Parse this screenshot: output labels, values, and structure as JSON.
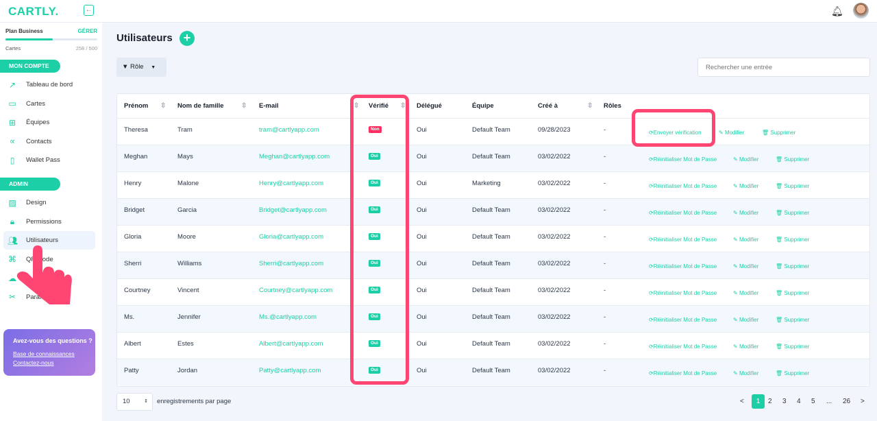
{
  "header": {
    "logo": "CARTLY.",
    "collapse_icon": "arrow-left-icon"
  },
  "plan": {
    "name": "Plan Business",
    "manage": "GÉRER",
    "cards_label": "Cartes",
    "cards_count": "258 / 500",
    "usage_fraction": 0.516
  },
  "sidebar": {
    "section_account": "MON COMPTE",
    "account_items": [
      {
        "label": "Tableau de bord",
        "icon": "↗"
      },
      {
        "label": "Cartes",
        "icon": "▭"
      },
      {
        "label": "Équipes",
        "icon": "⊞"
      },
      {
        "label": "Contacts",
        "icon": "∝"
      },
      {
        "label": "Wallet Pass",
        "icon": "▯"
      }
    ],
    "section_admin": "ADMIN",
    "admin_items": [
      {
        "label": "Design",
        "icon": "▨"
      },
      {
        "label": "Permissions",
        "icon": "🔒︎"
      },
      {
        "label": "Utilisateurs",
        "icon": "👥︎"
      },
      {
        "label": "QR Code",
        "icon": "⌘"
      },
      {
        "label": "",
        "icon": "☁"
      },
      {
        "label": "Paramètres",
        "icon": "✂"
      }
    ],
    "help": {
      "title": "Avez-vous des questions ?",
      "kb": "Base de connaissances",
      "contact": "Contactez-nous"
    }
  },
  "main": {
    "title": "Utilisateurs",
    "filter": "Rôle",
    "search_placeholder": "Rechercher une entrée"
  },
  "table": {
    "headers": [
      "Prénom",
      "Nom de famille",
      "E-mail",
      "Vérifié",
      "Délégué",
      "Équipe",
      "Créé à",
      "Rôles"
    ],
    "rows": [
      [
        "Theresa",
        "Tram",
        "tram@cartlyapp.com",
        "Non",
        "Oui",
        "Default Team",
        "09/28/2023",
        "-",
        "Envoyer vérification"
      ],
      [
        "Meghan",
        "Mays",
        "Meghan@cartlyapp.com",
        "Oui",
        "Oui",
        "Default Team",
        "03/02/2022",
        "-",
        "Réinitialiser Mot de Passe"
      ],
      [
        "Henry",
        "Malone",
        "Henry@cartlyapp.com",
        "Oui",
        "Oui",
        "Marketing",
        "03/02/2022",
        "-",
        "Réinitialiser Mot de Passe"
      ],
      [
        "Bridget",
        "Garcia",
        "Bridget@cartlyapp.com",
        "Oui",
        "Oui",
        "Default Team",
        "03/02/2022",
        "-",
        "Réinitialiser Mot de Passe"
      ],
      [
        "Gloria",
        "Moore",
        "Gloria@cartlyapp.com",
        "Oui",
        "Oui",
        "Default Team",
        "03/02/2022",
        "-",
        "Réinitialiser Mot de Passe"
      ],
      [
        "Sherri",
        "Williams",
        "Sherri@cartlyapp.com",
        "Oui",
        "Oui",
        "Default Team",
        "03/02/2022",
        "-",
        "Réinitialiser Mot de Passe"
      ],
      [
        "Courtney",
        "Vincent",
        "Courtney@cartlyapp.com",
        "Oui",
        "Oui",
        "Default Team",
        "03/02/2022",
        "-",
        "Réinitialiser Mot de Passe"
      ],
      [
        "Ms.",
        "Jennifer",
        "Ms.@cartlyapp.com",
        "Oui",
        "Oui",
        "Default Team",
        "03/02/2022",
        "-",
        "Réinitialiser Mot de Passe"
      ],
      [
        "Albert",
        "Estes",
        "Albert@cartlyapp.com",
        "Oui",
        "Oui",
        "Default Team",
        "03/02/2022",
        "-",
        "Réinitialiser Mot de Passe"
      ],
      [
        "Patty",
        "Jordan",
        "Patty@cartlyapp.com",
        "Oui",
        "Oui",
        "Default Team",
        "03/02/2022",
        "-",
        "Réinitialiser Mot de Passe"
      ]
    ],
    "edit": "Modifier",
    "delete": "Supprimer"
  },
  "footer": {
    "per_page": "10",
    "per_page_label": "enregistrements par page",
    "pages": [
      "<",
      "1",
      "2",
      "3",
      "4",
      "5",
      "...",
      "26",
      ">"
    ],
    "current": "1"
  },
  "colors": {
    "accent": "#1ccfa6",
    "highlight": "#ff4571",
    "no": "#ff2f62"
  }
}
